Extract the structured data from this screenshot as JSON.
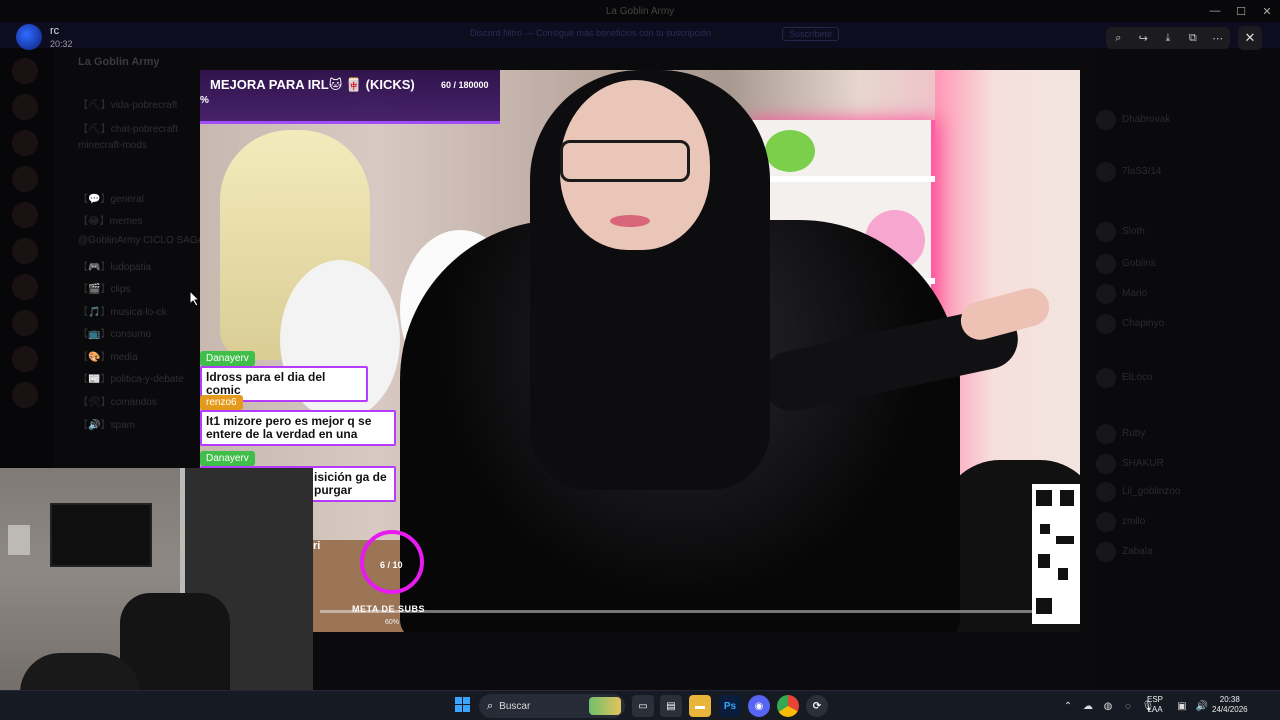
{
  "window": {
    "title": "La Goblin Army",
    "controls": [
      "—",
      "☐",
      "✕"
    ]
  },
  "banner": {
    "text": "Discord Nitro — Consigue más beneficios con tu suscripción",
    "button": "Suscríbete"
  },
  "server": {
    "name": "La Goblin Army",
    "channels": [
      "【⛏】vida-pobrecraft",
      "【⛏】chat-pobrecraft",
      "minecraft-mods",
      "【💬】general",
      "【😂】memes",
      "@GoblinArmy CICLO SAGA",
      "【🎮】ludopatia",
      "【🎬】clips",
      "【🎵】musica-lo-ck",
      "【📺】consumo",
      "【🎨】media",
      "【📰】politica-y-debate",
      "【🛠】comandos",
      "【🔊】spam"
    ]
  },
  "viewer": {
    "username": "rc",
    "time": "20:32",
    "tools": [
      "zoom-icon",
      "forward-icon",
      "download-icon",
      "open-external-icon",
      "more-icon"
    ],
    "close": "✕"
  },
  "stream": {
    "goal_title": "MEJORA PARA IRL🐱 🀄 (KICKS)",
    "goal_count": "60 / 180000",
    "goal_percent": "%",
    "chat": [
      {
        "name": "Danayerv",
        "message": "ldross para el dia del comic",
        "color": "#3fbf4a"
      },
      {
        "name": "renzo6",
        "message": "lt1 mizore pero es mejor q se entere de la verdad en una",
        "color": "#e49a1b"
      },
      {
        "name": "Danayerv",
        "message": "isición ga de purgar",
        "color": "#3fbf4a"
      }
    ],
    "sub_goal": {
      "count": "6 / 10",
      "label": "META DE SUBS",
      "percent": "60%",
      "progress": 0.6
    },
    "partial_label": "ri"
  },
  "members": [
    "Dhabrovak",
    "7laS3/14",
    "Sloth",
    "Goblins",
    "Mario",
    "Chapinyo",
    "ElLoco",
    "Ruby",
    "SHAKUR",
    "Lil_goblinzoo",
    "zmilo",
    "Zabala"
  ],
  "taskbar": {
    "search_placeholder": "Buscar",
    "apps": [
      "file-explorer",
      "photoshop",
      "discord",
      "chrome",
      "other"
    ],
    "language_line1": "ESP",
    "language_line2": "LAA",
    "time": "20:38",
    "date": "24/4/2026"
  },
  "colors": {
    "accent": "#a34bff",
    "ring": "#e51bf0",
    "taskbar": "#161a22"
  }
}
